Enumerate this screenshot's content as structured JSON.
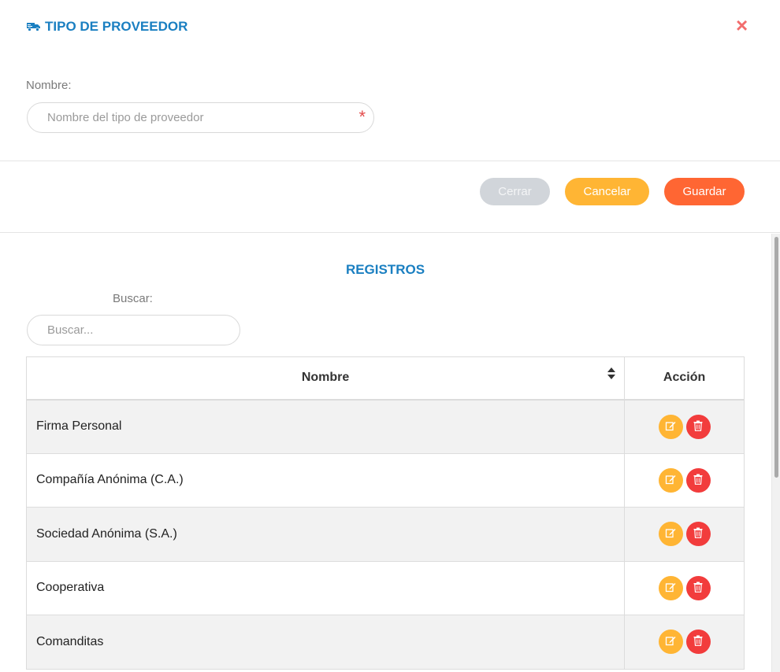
{
  "modal": {
    "title": "TIPO DE PROVEEDOR",
    "title_icon": "truck-icon",
    "close_symbol": "×"
  },
  "form": {
    "name_label": "Nombre:",
    "name_placeholder": "Nombre del tipo de proveedor",
    "name_value": "",
    "required_mark": "*"
  },
  "buttons": {
    "close": "Cerrar",
    "cancel": "Cancelar",
    "save": "Guardar"
  },
  "records": {
    "title": "REGISTROS",
    "search_label": "Buscar:",
    "search_placeholder": "Buscar...",
    "columns": {
      "name": "Nombre",
      "action": "Acción"
    },
    "rows": [
      {
        "name": "Firma Personal"
      },
      {
        "name": "Compañía Anónima (C.A.)"
      },
      {
        "name": "Sociedad Anónima (S.A.)"
      },
      {
        "name": "Cooperativa"
      },
      {
        "name": "Comanditas"
      }
    ],
    "row_actions": [
      "edit-icon",
      "trash-icon"
    ]
  },
  "colors": {
    "accent_blue": "#1a7fc1",
    "close_red": "#f26d6d",
    "cancel_orange": "#ffb534",
    "save_orange": "#ff6633",
    "delete_red": "#f23c3c",
    "disabled_gray": "#d1d5da"
  }
}
